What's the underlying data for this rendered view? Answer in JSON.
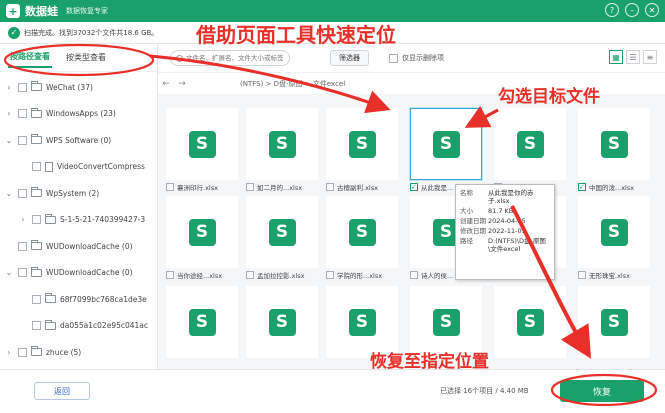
{
  "titlebar": {
    "logo": "+",
    "app_name": "数据蛙",
    "app_sub": "数据恢复专家",
    "controls": [
      "?",
      "–",
      "✕"
    ]
  },
  "scan_status": {
    "text": "扫描完成。找到37032个文件共18.6 GB。"
  },
  "tabs": [
    {
      "label": "按路径查看",
      "active": true
    },
    {
      "label": "按类型查看",
      "active": false
    }
  ],
  "tree": [
    {
      "label": "WeChat (37)",
      "kind": "folder",
      "expand": "›",
      "indent": 0,
      "checked": false
    },
    {
      "label": "WindowsApps (23)",
      "kind": "folder",
      "expand": "›",
      "indent": 0,
      "checked": false
    },
    {
      "label": "WPS Software (0)",
      "kind": "folder",
      "expand": "⌄",
      "indent": 0,
      "checked": false
    },
    {
      "label": "VideoConvertCompress",
      "kind": "file",
      "expand": "",
      "indent": 1,
      "checked": false
    },
    {
      "label": "WpSystem (2)",
      "kind": "folder",
      "expand": "⌄",
      "indent": 0,
      "checked": false
    },
    {
      "label": "S-1-5-21-740399427-3",
      "kind": "folder",
      "expand": "›",
      "indent": 1,
      "checked": false
    },
    {
      "label": "WUDownloadCache (0)",
      "kind": "folder",
      "expand": "",
      "indent": 0,
      "checked": false
    },
    {
      "label": "WUDownloadCache (0)",
      "kind": "folder",
      "expand": "⌄",
      "indent": 0,
      "checked": false
    },
    {
      "label": "68f7099bc768ca1de3e",
      "kind": "folder",
      "expand": "",
      "indent": 1,
      "checked": false
    },
    {
      "label": "da055a1c02e95c041ac",
      "kind": "folder",
      "expand": "",
      "indent": 1,
      "checked": false
    },
    {
      "label": "zhuce (5)",
      "kind": "folder",
      "expand": "›",
      "indent": 0,
      "checked": false
    }
  ],
  "toolbar": {
    "search_placeholder": "文件名、扩展名、文件大小或标签",
    "filter_label": "筛选器",
    "deleted_only_label": "仅显示删除项",
    "views": [
      "▦",
      "☰",
      "≡"
    ]
  },
  "path": {
    "back": "←",
    "forward": "→",
    "text": "(NTFS) > D盘-原图 > 文件excel"
  },
  "files": [
    {
      "name": "襄洲印行.xlsx",
      "checked": false
    },
    {
      "name": "如二月的...xlsx",
      "checked": false
    },
    {
      "name": "古檀副利.xlsx",
      "checked": false
    },
    {
      "name": "从此我是...",
      "checked": true,
      "selected": true
    },
    {
      "name": "朗朗的...",
      "checked": false
    },
    {
      "name": "中国的泼...xlsx",
      "checked": true
    },
    {
      "name": "当你途经...xlsx",
      "checked": false
    },
    {
      "name": "孟加拉控影.xlsx",
      "checked": false
    },
    {
      "name": "学院的形...xlsx",
      "checked": false
    },
    {
      "name": "诗人的侯...",
      "checked": false
    },
    {
      "name": "",
      "checked": false
    },
    {
      "name": "无形珠宝.xlsx",
      "checked": false
    },
    {
      "name": "",
      "checked": false
    },
    {
      "name": "",
      "checked": false
    },
    {
      "name": "",
      "checked": false
    },
    {
      "name": "",
      "checked": false
    },
    {
      "name": "",
      "checked": false
    },
    {
      "name": "",
      "checked": false
    }
  ],
  "tooltip": {
    "rows": [
      {
        "key": "名称",
        "value": "从此我是你的赤子.xlsx"
      },
      {
        "key": "大小",
        "value": "81.7 KB"
      },
      {
        "key": "创建日期",
        "value": "2024-04-15"
      },
      {
        "key": "修改日期",
        "value": "2022-11-01"
      },
      {
        "key": "路径",
        "value": "D:(NTFS)\\D盘-原图\\文件excel"
      }
    ]
  },
  "bottom": {
    "back_label": "返回",
    "selection_info": "已选择 16个项目 / 4.40 MB",
    "recover_label": "恢复"
  },
  "annotations": {
    "top": "借助页面工具快速定位",
    "right": "勾选目标文件",
    "bottom": "恢复至指定位置"
  },
  "colors": {
    "brand_green": "#1aa06a",
    "annotation_red": "#e8302b"
  }
}
